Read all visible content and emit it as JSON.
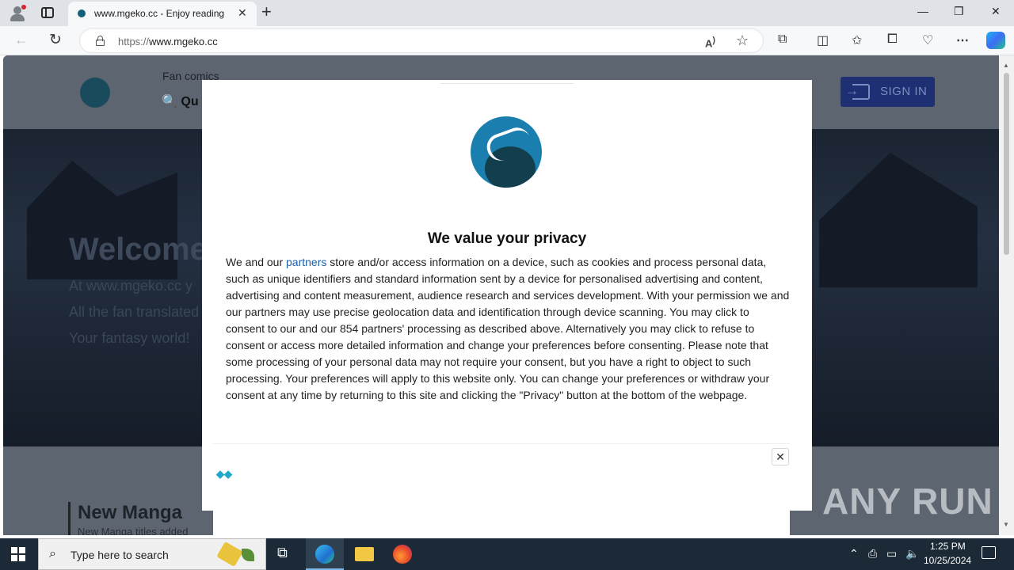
{
  "browser": {
    "tab_title": "www.mgeko.cc - Enjoy reading",
    "url_protocol": "https://",
    "url_host": "www.mgeko.cc",
    "tab_close_glyph": "✕",
    "new_tab_glyph": "+",
    "window_controls": {
      "minimize": "—",
      "maximize": "❐",
      "close": "✕"
    },
    "icons": [
      "read-aloud-icon",
      "favorite-icon",
      "extensions-icon",
      "split-screen-icon",
      "favorites-icon",
      "collections-icon",
      "performance-icon",
      "more-icon",
      "copilot-icon"
    ]
  },
  "site": {
    "fan_comics": "Fan comics",
    "quick_search": "Qu",
    "signin": "SIGN IN",
    "hero_title": "Welcome",
    "hero_lines": [
      "At www.mgeko.cc y",
      "All the fan translated",
      "Your fantasy world!"
    ],
    "new_manga": "New Manga",
    "new_manga_sub": "New Manga titles added"
  },
  "consent": {
    "title": "We value your privacy",
    "body_pre": "We and our ",
    "partners_link": "partners",
    "body_post": " store and/or access information on a device, such as cookies and process personal data, such as unique identifiers and standard information sent by a device for personalised advertising and content, advertising and content measurement, audience research and services development. With your permission we and our partners may use precise geolocation data and identification through device scanning. You may click to consent to our and our 854 partners' processing as described above. Alternatively you may click to refuse to consent or access more detailed information and change your preferences before consenting. Please note that some processing of your personal data may not require your consent, but you have a right to object to such processing. Your preferences will apply to this website only. You can change your preferences or withdraw your consent at any time by returning to this site and clicking the \"Privacy\" button at the bottom of the webpage."
  },
  "ad": {
    "close_glyph": "✕"
  },
  "watermark": "ANY RUN",
  "taskbar": {
    "search_placeholder": "Type here to search",
    "time": "1:25 PM",
    "date": "10/25/2024"
  },
  "colors": {
    "signin_bg": "#1f2f73",
    "link": "#1a5fa8",
    "taskbar": "#1b2a36"
  }
}
